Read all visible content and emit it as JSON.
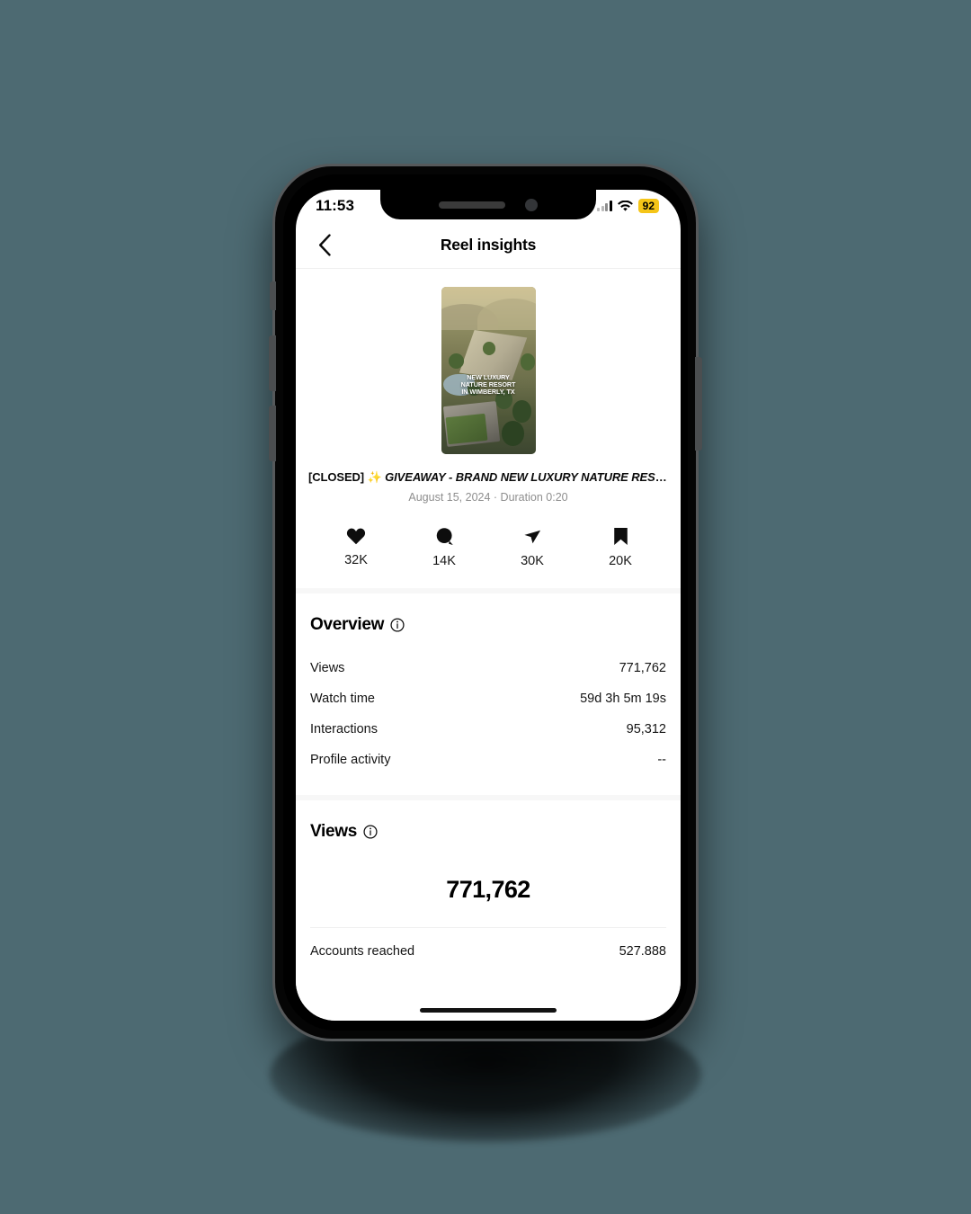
{
  "status_bar": {
    "time": "11:53",
    "signal_icon": "cellular-signal-icon",
    "wifi_icon": "wifi-icon",
    "battery_level": "92",
    "battery_accent": "#f5c518"
  },
  "nav": {
    "back_icon": "chevron-left-icon",
    "title": "Reel insights"
  },
  "post": {
    "thumbnail": {
      "alt": "aerial view of nature resort",
      "overlay_lines": [
        "NEW LUXURY",
        "NATURE RESORT",
        "IN WIMBERLY, TX"
      ]
    },
    "caption_prefix": "[CLOSED] ",
    "caption_sparkle": "✨ ",
    "caption_body": "GIVEAWAY - BRAND NEW LUXURY NATURE RESO…",
    "meta": "August 15, 2024 · Duration 0:20"
  },
  "engagement": [
    {
      "icon": "heart-icon",
      "label": "likes",
      "value": "32K"
    },
    {
      "icon": "comment-icon",
      "label": "comments",
      "value": "14K"
    },
    {
      "icon": "share-icon",
      "label": "shares",
      "value": "30K"
    },
    {
      "icon": "bookmark-icon",
      "label": "saves",
      "value": "20K"
    }
  ],
  "overview": {
    "title": "Overview",
    "info_icon": "info-icon",
    "rows": [
      {
        "label": "Views",
        "value": "771,762"
      },
      {
        "label": "Watch time",
        "value": "59d 3h 5m 19s"
      },
      {
        "label": "Interactions",
        "value": "95,312"
      },
      {
        "label": "Profile activity",
        "value": "--"
      }
    ]
  },
  "views_section": {
    "title": "Views",
    "info_icon": "info-icon",
    "big_number": "771,762",
    "rows": [
      {
        "label": "Accounts reached",
        "value": "527.888"
      }
    ]
  }
}
